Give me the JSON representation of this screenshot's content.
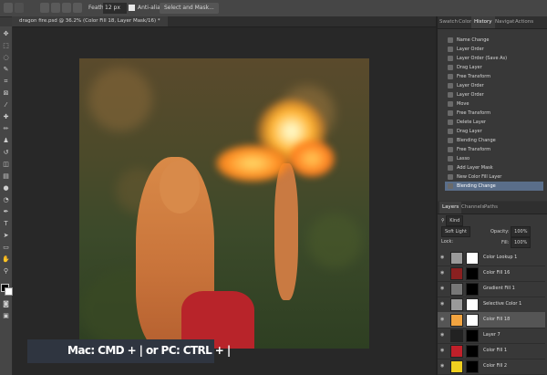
{
  "options_bar": {
    "feather_label": "Feather:",
    "feather_value": "12 px",
    "anti_alias_label": "Anti-alias",
    "select_mask_label": "Select and Mask..."
  },
  "document_tab": {
    "title": "dragon fire.psd @ 36.2% (Color Fill 18, Layer Mask/16) *"
  },
  "panel_tabs": {
    "top": [
      "Swatch",
      "Color",
      "History",
      "Navigat",
      "Actions"
    ],
    "top_active": "History",
    "layers": [
      "Layers",
      "Channels",
      "Paths"
    ],
    "layers_active": "Layers"
  },
  "history": {
    "items": [
      "Name Change",
      "Layer Order",
      "Layer Order (Save As)",
      "Drag Layer",
      "Free Transform",
      "Layer Order",
      "Layer Order",
      "Move",
      "Free Transform",
      "Delete Layer",
      "Drag Layer",
      "Blending Change",
      "Free Transform",
      "Lasso",
      "Add Layer Mask",
      "New Color Fill Layer",
      "Blending Change"
    ],
    "selected_index": 16
  },
  "layers_panel": {
    "kind_label": "Kind",
    "blend_mode": "Soft Light",
    "opacity_label": "Opacity:",
    "opacity_value": "100%",
    "lock_label": "Lock:",
    "fill_label": "Fill:",
    "fill_value": "100%",
    "layers": [
      {
        "name": "Color Lookup 1",
        "thumb": "#9a9a9a",
        "mask": "#ffffff"
      },
      {
        "name": "Color Fill 16",
        "thumb": "#8a2020",
        "mask": "#000000"
      },
      {
        "name": "Gradient Fill 1",
        "thumb": "#777777",
        "mask": "#000000"
      },
      {
        "name": "Selective Color 1",
        "thumb": "#9a9a9a",
        "mask": "#ffffff"
      },
      {
        "name": "Color Fill 18",
        "thumb": "#f2a440",
        "mask": "#ffffff"
      },
      {
        "name": "Layer 7",
        "thumb": "#222222",
        "mask": "#000000"
      },
      {
        "name": "Color Fill 1",
        "thumb": "#c0202a",
        "mask": "#000000"
      },
      {
        "name": "Color Fill 2",
        "thumb": "#f0d020",
        "mask": "#000000"
      }
    ],
    "selected_index": 4
  },
  "caption": {
    "text": "Mac: CMD + | or PC: CTRL + |"
  }
}
